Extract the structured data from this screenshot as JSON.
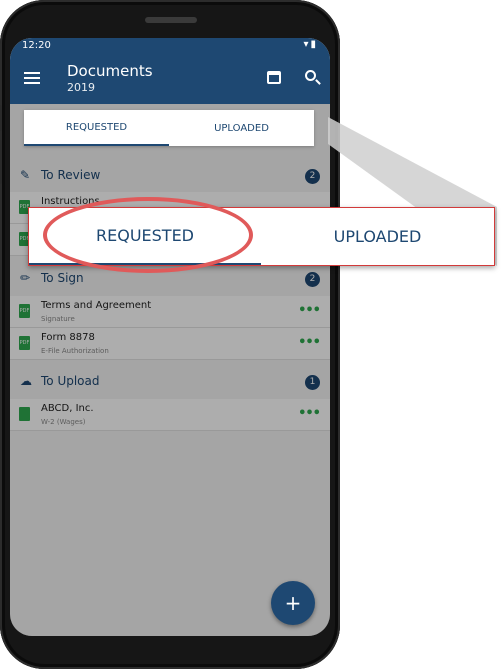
{
  "status_bar": {
    "time": "12:20",
    "icons": "▾▮"
  },
  "app_bar": {
    "title": "Documents",
    "year": "2019"
  },
  "tabs": [
    {
      "label": "REQUESTED"
    },
    {
      "label": "UPLOADED"
    }
  ],
  "sections": [
    {
      "icon": "review-icon",
      "label": "To Review",
      "count": "2",
      "items": [
        {
          "title": "Instructions",
          "subtitle": ""
        },
        {
          "title": "",
          "subtitle": ""
        }
      ]
    },
    {
      "icon": "pencil-icon",
      "label": "To Sign",
      "count": "2",
      "items": [
        {
          "title": "Terms and Agreement",
          "subtitle": "Signature"
        },
        {
          "title": "Form 8878",
          "subtitle": "E-File Authorization"
        }
      ]
    },
    {
      "icon": "cloud-upload-icon",
      "label": "To Upload",
      "count": "1",
      "items": [
        {
          "title": "ABCD, Inc.",
          "subtitle": "W-2 (Wages)"
        }
      ]
    }
  ],
  "file_badge": "PDF",
  "more_glyph": "•••",
  "fab_label": "+",
  "zoom": {
    "tabs": [
      {
        "label": "REQUESTED"
      },
      {
        "label": "UPLOADED"
      }
    ]
  },
  "colors": {
    "primary": "#1e4872",
    "accent_green": "#2fa84f",
    "highlight_red": "#e05a5a"
  }
}
